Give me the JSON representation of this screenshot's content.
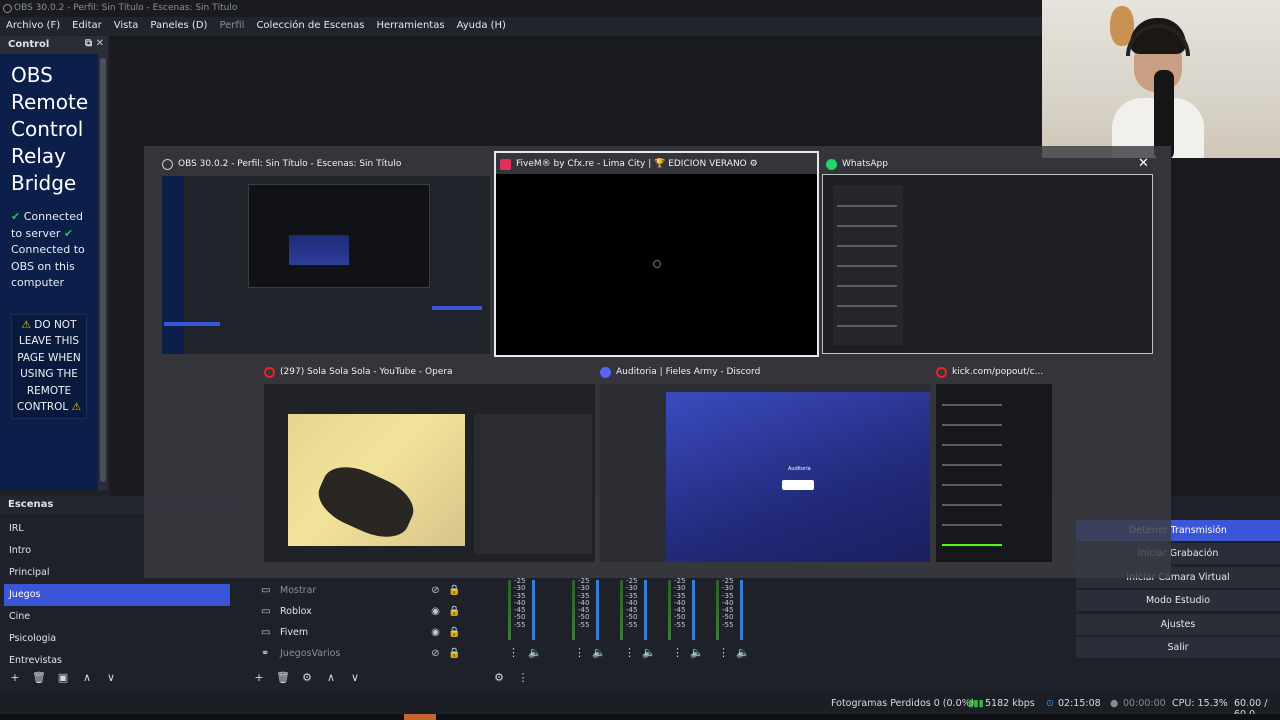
{
  "window": {
    "title": "OBS 30.0.2 - Perfil: Sin Título - Escenas: Sin Título"
  },
  "menu": {
    "items": [
      "Archivo (F)",
      "Editar",
      "Vista",
      "Paneles (D)",
      "Perfil",
      "Colección de Escenas",
      "Herramientas",
      "Ayuda (H)"
    ]
  },
  "control_dock": {
    "title": "Control",
    "relay_title": [
      "OBS",
      "Remote",
      "Control",
      "Relay",
      "Bridge"
    ],
    "status_server": "Connected to server",
    "status_obs": "Connected to OBS on this computer",
    "warning": "DO NOT LEAVE THIS PAGE WHEN USING THE REMOTE CONTROL"
  },
  "scenes": {
    "title": "Escenas",
    "items": [
      "IRL",
      "Intro",
      "Principal",
      "Juegos",
      "Cine",
      "Psicologia",
      "Entrevistas"
    ],
    "active": "Juegos"
  },
  "sources": {
    "items": [
      {
        "name": "Mostrar",
        "type_icon": "window-icon",
        "visible": false,
        "locked": true
      },
      {
        "name": "Roblox",
        "type_icon": "window-icon",
        "visible": true,
        "locked": true
      },
      {
        "name": "Fivem",
        "type_icon": "window-icon",
        "visible": true,
        "locked": true
      },
      {
        "name": "JuegosVarios",
        "type_icon": "link-icon",
        "visible": false,
        "locked": true
      }
    ]
  },
  "mixer": {
    "scale": [
      "-25",
      "-30",
      "-35",
      "-40",
      "-45",
      "-50",
      "-55"
    ]
  },
  "controls": {
    "items": [
      "Detener Transmisión",
      "Iniciar Grabación",
      "Iniciar Cámara Virtual",
      "Modo Estudio",
      "Ajustes",
      "Salir"
    ]
  },
  "statusbar": {
    "frames_dropped": "Fotogramas Perdidos 0 (0.0%)",
    "bitrate": "5182 kbps",
    "stream_time": "02:15:08",
    "rec_time": "00:00:00",
    "cpu": "CPU: 15.3%",
    "fps": "60.00 / 60.0"
  },
  "switcher": {
    "windows": [
      {
        "title": "OBS 30.0.2 - Perfil: Sin Título - Escenas: Sin Título",
        "icon_color": "#3b3d44"
      },
      {
        "title": "FiveM® by Cfx.re - Lima City | 🏆 EDICION VERANO ⚙",
        "icon_color": "#e0315a"
      },
      {
        "title": "WhatsApp",
        "icon_color": "#25d366"
      },
      {
        "title": "(297) Sola Sola Sola - YouTube - Opera",
        "icon_color": "#e3242b"
      },
      {
        "title": "Auditoria | Fieles Army - Discord",
        "icon_color": "#5865f2"
      },
      {
        "title": "kick.com/popout/c...",
        "icon_color": "#e3242b"
      }
    ],
    "discord_label": "Auditoria"
  },
  "colors": {
    "accent": "#3a56d6",
    "relay_bg": "#0b1f4a",
    "connected": "#27c24c",
    "warning": "#f2c200"
  }
}
